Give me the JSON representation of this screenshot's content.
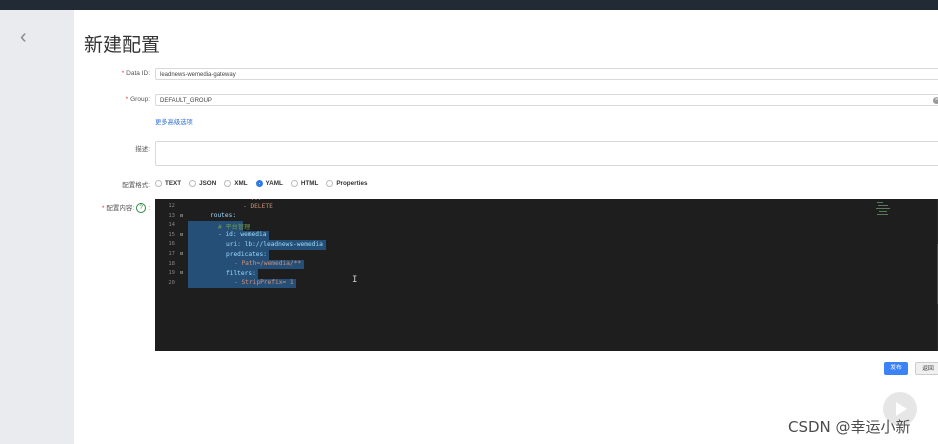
{
  "header": {
    "title": "新建配置"
  },
  "form": {
    "data_id": {
      "label": "Data ID:",
      "value": "leadnews-wemedia-gateway"
    },
    "group": {
      "label": "Group:",
      "value": "DEFAULT_GROUP"
    },
    "advanced_link": "更多高级选项",
    "description": {
      "label": "描述:"
    },
    "format": {
      "label": "配置格式:",
      "options": [
        "TEXT",
        "JSON",
        "XML",
        "YAML",
        "HTML",
        "Properties"
      ],
      "selected": "YAML"
    },
    "content": {
      "label": "配置内容:",
      "help": "?",
      "suffix": ":"
    }
  },
  "editor": {
    "lines": [
      {
        "num": "12",
        "fold": "",
        "text": "- DELETE",
        "selected": false
      },
      {
        "num": "13",
        "fold": "⊟",
        "text": "routes:",
        "selected": false
      },
      {
        "num": "14",
        "fold": "",
        "text": "# 平台管理",
        "selected": true
      },
      {
        "num": "15",
        "fold": "⊟",
        "text": "- id: wemedia",
        "selected": true
      },
      {
        "num": "16",
        "fold": "",
        "text": "uri: lb://leadnews-wemedia",
        "selected": true
      },
      {
        "num": "17",
        "fold": "⊟",
        "text": "predicates:",
        "selected": true
      },
      {
        "num": "18",
        "fold": "",
        "text": "- Path=/wemedia/**",
        "selected": true
      },
      {
        "num": "19",
        "fold": "⊟",
        "text": "filters:",
        "selected": true
      },
      {
        "num": "20",
        "fold": "",
        "text": "- StripPrefix= 1",
        "selected": true
      }
    ],
    "partial_top_line": "- ...",
    "cursor": "I"
  },
  "buttons": {
    "publish": "发布",
    "back": "返回"
  },
  "watermark": "CSDN @幸运小新",
  "colors": {
    "accent": "#3b82f6",
    "required": "#e4393c",
    "editor_bg": "#1e1e1e",
    "selection": "#264f78"
  }
}
